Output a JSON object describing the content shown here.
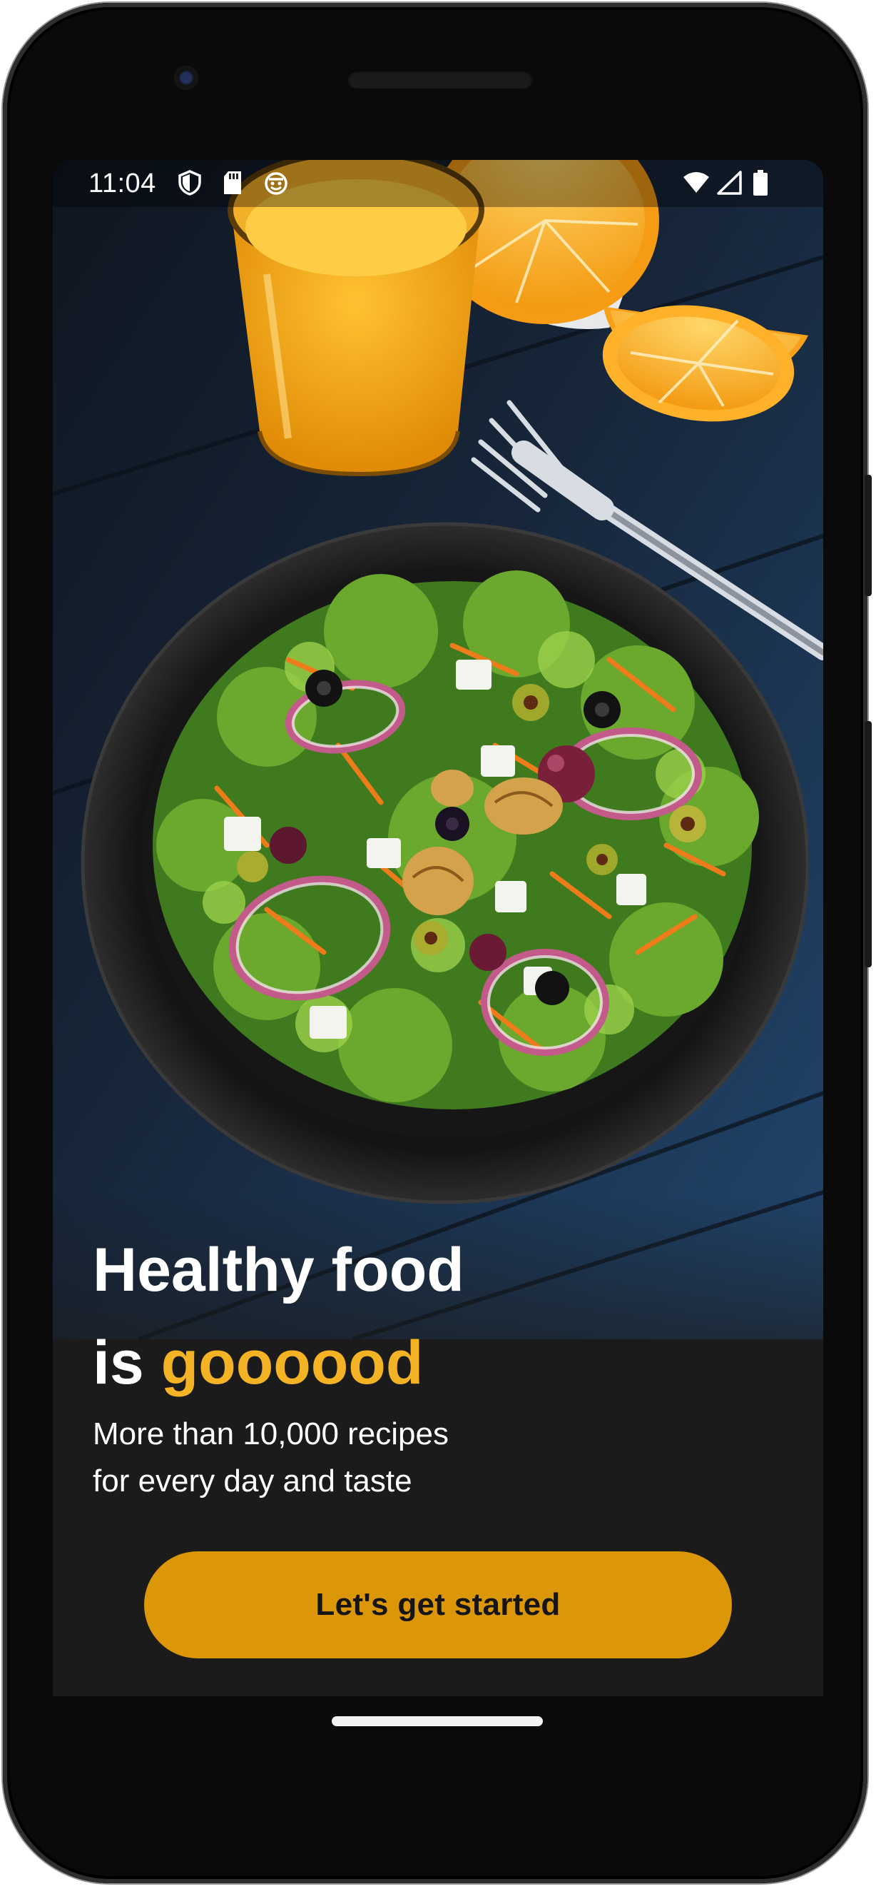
{
  "status_bar": {
    "time": "11:04",
    "left_icons": [
      "shield-icon",
      "sd-card-icon",
      "smiley-notification-icon"
    ],
    "right_icons": [
      "wifi-icon",
      "cell-signal-icon",
      "battery-icon"
    ]
  },
  "hero": {
    "image": "salad-bowl-with-orange-juice-and-fork-photo"
  },
  "onboarding": {
    "headline_line1": "Healthy food",
    "headline_line2_prefix": "is ",
    "headline_line2_accent": "goooood",
    "subtitle": "More than 10,000 recipes\nfor every day and taste",
    "cta_label": "Let's get started"
  },
  "colors": {
    "accent_text": "#f3b324",
    "button_bg": "#dc9708",
    "screen_bg": "#1b1b1b"
  }
}
